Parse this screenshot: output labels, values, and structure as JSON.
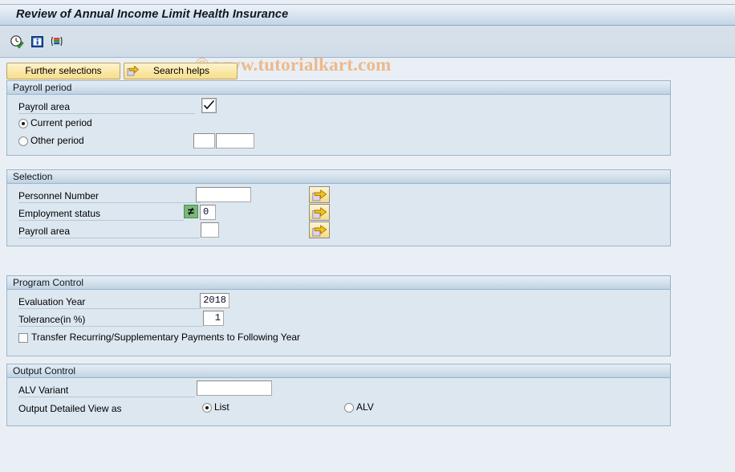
{
  "window": {
    "title": "Review of Annual Income Limit Health Insurance"
  },
  "watermark": {
    "text": "© www.tutorialkart.com"
  },
  "toolbar": {
    "icons": [
      {
        "name": "execute-clock-icon",
        "title": "Execute"
      },
      {
        "name": "information-icon",
        "title": "Information"
      },
      {
        "name": "color-bars-icon",
        "title": "Variants"
      }
    ]
  },
  "buttons": {
    "further_selections": "Further selections",
    "search_helps": "Search helps"
  },
  "payroll_period": {
    "header": "Payroll period",
    "payroll_area_label": "Payroll area",
    "payroll_area_checked": true,
    "current_period_label": "Current period",
    "current_period_selected": true,
    "other_period_label": "Other period",
    "other_period_selected": false,
    "other_period_value_1": "",
    "other_period_value_2": ""
  },
  "selection": {
    "header": "Selection",
    "rows": [
      {
        "label": "Personnel Number",
        "value": "",
        "operator": "",
        "has_operator": false
      },
      {
        "label": "Employment status",
        "value": "0",
        "operator": "≠",
        "has_operator": true
      },
      {
        "label": "Payroll area",
        "value": "",
        "operator": "",
        "has_operator": false
      }
    ],
    "multi_select_title": "Multiple selection"
  },
  "program_control": {
    "header": "Program Control",
    "evaluation_year_label": "Evaluation Year",
    "evaluation_year_value": "2018",
    "tolerance_label": "Tolerance(in %)",
    "tolerance_value": "1",
    "transfer_label": "Transfer Recurring/Supplementary Payments to Following Year",
    "transfer_checked": false
  },
  "output_control": {
    "header": "Output Control",
    "alv_variant_label": "ALV Variant",
    "alv_variant_value": "",
    "detailed_view_label": "Output Detailed View as",
    "option_list_label": "List",
    "option_list_selected": true,
    "option_alv_label": "ALV",
    "option_alv_selected": false
  },
  "colors": {
    "page_background": "#eaeff5",
    "panel_background": "#dde7f0",
    "panel_border": "#9bb4cb",
    "button_yellow": "#fbe9a9",
    "watermark": "#edb98a",
    "operator_green": "#7ab87a"
  }
}
